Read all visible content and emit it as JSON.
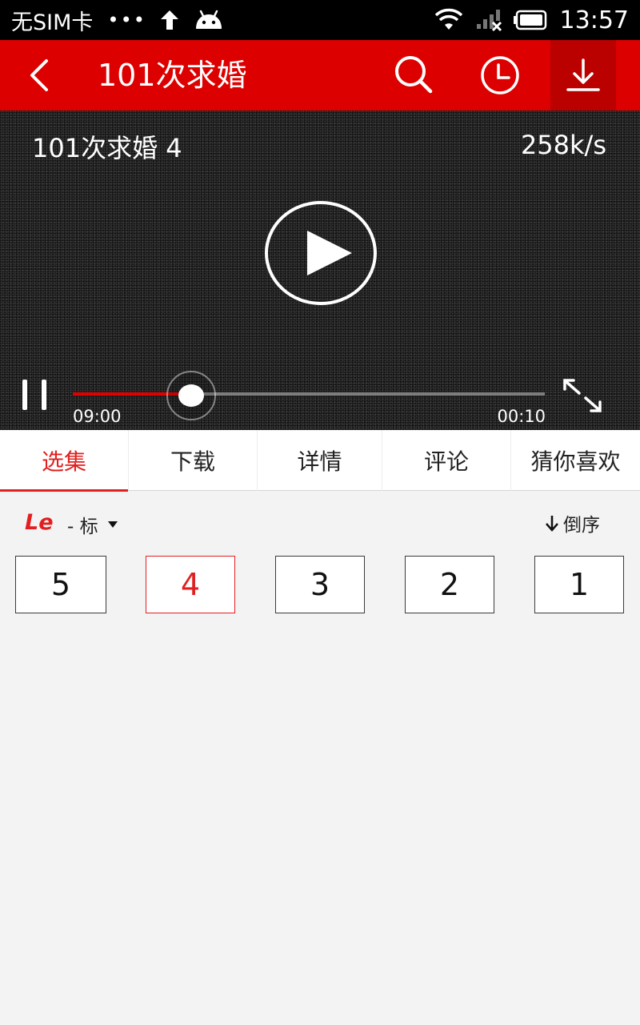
{
  "status_bar": {
    "carrier": "无SIM卡",
    "dots": "•••",
    "time": "13:57"
  },
  "appbar": {
    "title": "101次求婚",
    "back_icon": "back-arrow-icon",
    "search_icon": "search-icon",
    "history_icon": "clock-icon",
    "download_icon": "download-icon",
    "brand_color": "#dd0000"
  },
  "player": {
    "episode_title": "101次求婚 4",
    "speed": "258k/s",
    "current_time": "09:00",
    "total_time": "00:10",
    "progress": 0.25
  },
  "tabs": [
    {
      "label": "选集",
      "active": true
    },
    {
      "label": "下载",
      "active": false
    },
    {
      "label": "详情",
      "active": false
    },
    {
      "label": "评论",
      "active": false
    },
    {
      "label": "猜你喜欢",
      "active": false
    }
  ],
  "source": {
    "logo": "Le",
    "quality": "- 标",
    "sort_label": "倒序",
    "sort_icon": "arrow-down-icon"
  },
  "episodes": [
    {
      "label": "5",
      "selected": false
    },
    {
      "label": "4",
      "selected": true
    },
    {
      "label": "3",
      "selected": false
    },
    {
      "label": "2",
      "selected": false
    },
    {
      "label": "1",
      "selected": false
    }
  ]
}
